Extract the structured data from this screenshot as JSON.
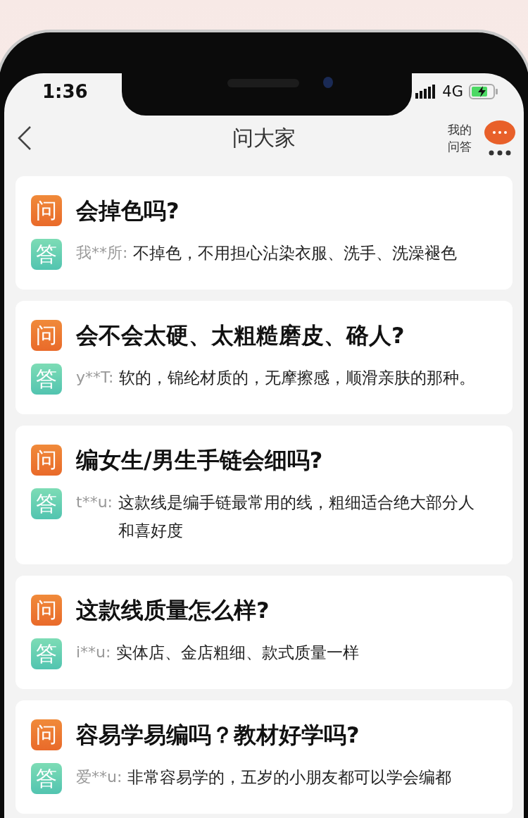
{
  "status_bar": {
    "time": "1:36",
    "network": "4G"
  },
  "header": {
    "title": "问大家",
    "my_qa": "我的问答"
  },
  "questions": [
    {
      "q_mark": "问",
      "question": "会掉色吗?",
      "a_mark": "答",
      "user": "我**所:",
      "answer": "不掉色，不用担心沾染衣服、洗手、洗澡褪色"
    },
    {
      "q_mark": "问",
      "question": "会不会太硬、太粗糙磨皮、硌人?",
      "a_mark": "答",
      "user": "y**T:",
      "answer": "软的，锦纶材质的，无摩擦感，顺滑亲肤的那种。"
    },
    {
      "q_mark": "问",
      "question": "编女生/男生手链会细吗?",
      "a_mark": "答",
      "user": "t**u:",
      "answer": "这款线是编手链最常用的线，粗细适合绝大部分人和喜好度"
    },
    {
      "q_mark": "问",
      "question": "这款线质量怎么样?",
      "a_mark": "答",
      "user": "i**u:",
      "answer": "实体店、金店粗细、款式质量一样"
    },
    {
      "q_mark": "问",
      "question": "容易学易编吗？教材好学吗?",
      "a_mark": "答",
      "user": "爱**u:",
      "answer": "非常容易学的，五岁的小朋友都可以学会编都"
    }
  ]
}
